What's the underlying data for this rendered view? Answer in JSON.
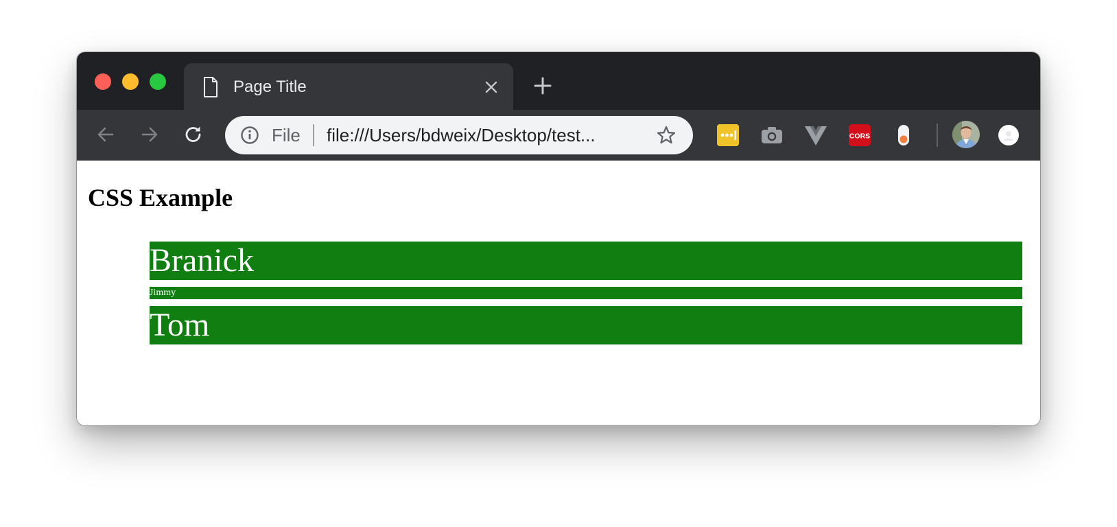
{
  "browser": {
    "tab": {
      "title": "Page Title",
      "icon": "document-icon"
    },
    "toolbar": {
      "back_icon": "arrow-left-icon",
      "forward_icon": "arrow-right-icon",
      "reload_icon": "reload-icon",
      "omnibox": {
        "scheme_label": "File",
        "url": "file:///Users/bdweix/Desktop/test..."
      },
      "extensions": [
        {
          "name": "lastpass-icon",
          "color": "#f0c428"
        },
        {
          "name": "camera-icon",
          "color": "#9aa0a6"
        },
        {
          "name": "vue-devtools-icon",
          "color": "#9aa0a6"
        },
        {
          "name": "cors-icon",
          "label": "CORS",
          "color": "#d20f1a"
        },
        {
          "name": "toggle-icon",
          "color": "#f07e3d"
        }
      ]
    }
  },
  "page": {
    "heading": "CSS Example",
    "items": [
      {
        "label": "Branick",
        "size": "large"
      },
      {
        "label": "Jimmy",
        "size": "small"
      },
      {
        "label": "Tom",
        "size": "large"
      }
    ],
    "item_background": "#117e11",
    "item_text_color": "#ffffff"
  }
}
